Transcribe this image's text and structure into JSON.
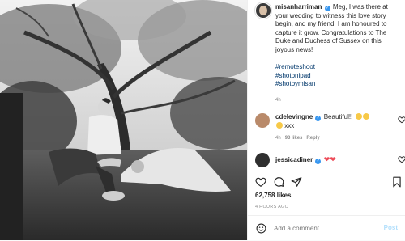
{
  "post": {
    "username": "misanharriman",
    "caption_text": "Meg, I was there at your wedding to witness this love story begin, and my friend, I am honoured to capture it grow. Congratulations to The Duke and Duchess of Sussex on this joyous news!",
    "hashtags": [
      "#remoteshoot",
      "#shotonipad",
      "#shotbymisan"
    ],
    "time": "4h",
    "likes": "62,758 likes",
    "posted_ago": "4 HOURS AGO"
  },
  "comments": [
    {
      "username": "cdelevingne",
      "text": "Beautiful!!",
      "text2": "xxx",
      "time": "4h",
      "likes": "93 likes",
      "reply": "Reply"
    },
    {
      "username": "jessicadiner",
      "text": "❤❤"
    }
  ],
  "add_comment": {
    "placeholder": "Add a comment…",
    "post_label": "Post"
  },
  "icons": [
    "heart-icon",
    "comment-icon",
    "share-icon",
    "bookmark-icon",
    "smile-icon",
    "verified-icon"
  ],
  "colors": {
    "link": "#00376b",
    "verified": "#3897f0",
    "post_button": "#b2dffc",
    "heart_red": "#ed4956"
  }
}
